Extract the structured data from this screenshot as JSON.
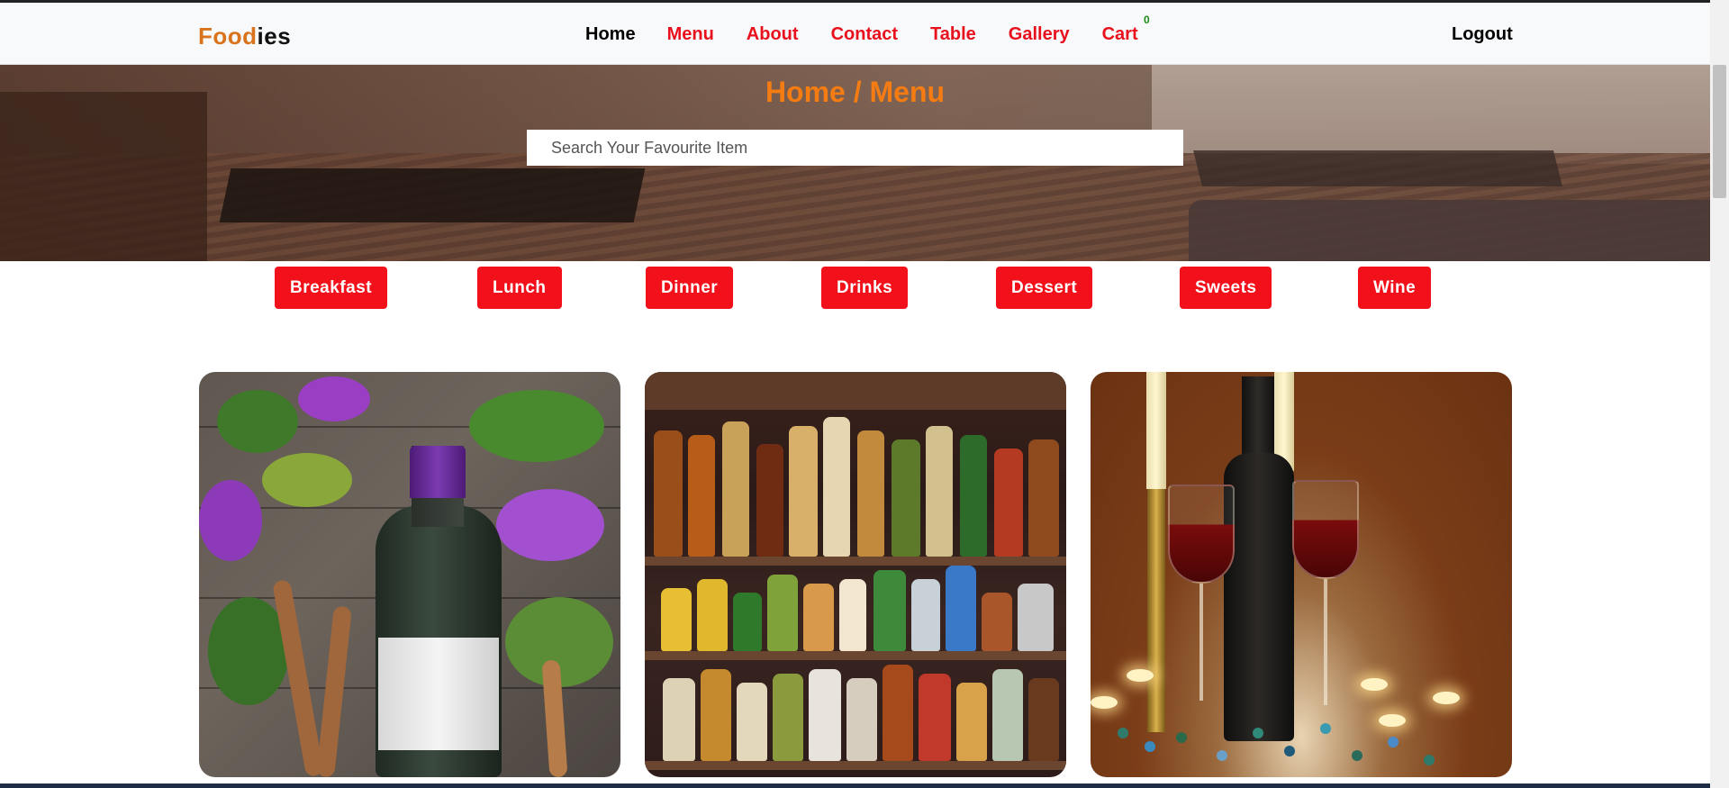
{
  "brand": {
    "part1": "Food",
    "part2": "ies"
  },
  "nav": {
    "items": [
      {
        "label": "Home"
      },
      {
        "label": "Menu"
      },
      {
        "label": "About"
      },
      {
        "label": "Contact"
      },
      {
        "label": "Table"
      },
      {
        "label": "Gallery"
      },
      {
        "label": "Cart"
      }
    ],
    "cart_count": "0",
    "logout_label": "Logout"
  },
  "hero": {
    "title": "Home / Menu",
    "search_placeholder": "Search Your Favourite Item"
  },
  "categories": [
    "Breakfast",
    "Lunch",
    "Dinner",
    "Drinks",
    "Dessert",
    "Sweets",
    "Wine"
  ],
  "colors": {
    "brand_orange": "#d9731c",
    "nav_red": "#e8101d",
    "category_button": "#f2101a",
    "hero_title": "#f47c12",
    "cart_badge": "#1a8a17"
  }
}
